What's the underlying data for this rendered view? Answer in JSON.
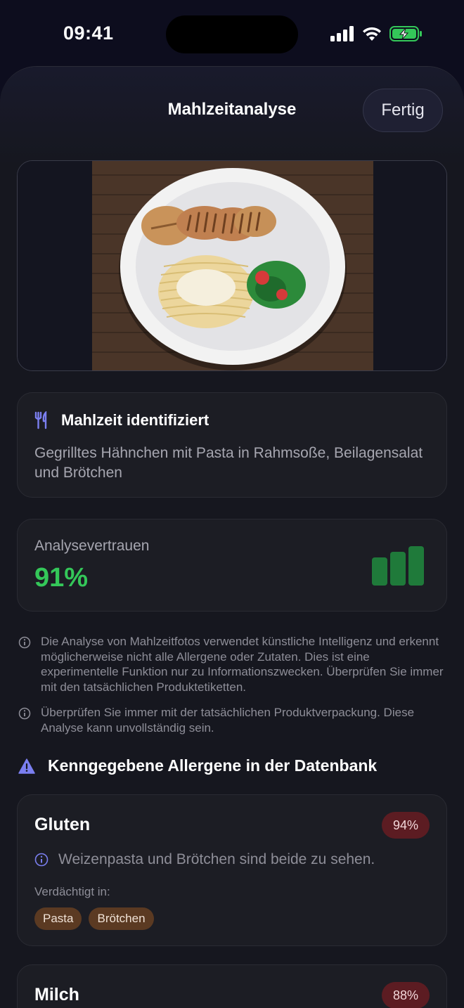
{
  "status_bar": {
    "time": "09:41",
    "icons": [
      "cellular-signal-icon",
      "wifi-icon",
      "battery-charging-icon"
    ]
  },
  "nav": {
    "title": "Mahlzeitanalyse",
    "done_label": "Fertig"
  },
  "photo": {
    "alt_icon": "meal-photo"
  },
  "meal_card": {
    "icon": "fork-knife-icon",
    "title": "Mahlzeit identifiziert",
    "description": "Gegrilltes Hähnchen mit Pasta in Rahmsoße, Beilagensalat und Brötchen"
  },
  "confidence_card": {
    "label": "Analysevertrauen",
    "value": "91%",
    "level": 0.91,
    "color": "#34c759"
  },
  "disclaimers": [
    "Die Analyse von Mahlzeitfotos verwendet künstliche Intelligenz und erkennt möglicherweise nicht alle Allergene oder Zutaten. Dies ist eine experimentelle Funktion nur zu Informationszwecken. Überprüfen Sie immer mit den tatsächlichen Produktetiketten.",
    "Überprüfen Sie immer mit der tatsächlichen Produktverpackung. Diese Analyse kann unvollständig sein."
  ],
  "allergens_section": {
    "icon": "warning-triangle-icon",
    "title": "Kenngegebene Allergene in der Datenbank"
  },
  "allergens": [
    {
      "name": "Gluten",
      "confidence": "94%",
      "reason": "Weizenpasta und Brötchen sind beide zu sehen.",
      "suspect_label": "Verdächtigt in:",
      "items": [
        "Pasta",
        "Brötchen"
      ]
    },
    {
      "name": "Milch",
      "confidence": "88%"
    }
  ],
  "colors": {
    "accent": "#34c759",
    "badge": "#5c1c22",
    "chip": "#5b3a22",
    "info": "#7b7ff0"
  }
}
